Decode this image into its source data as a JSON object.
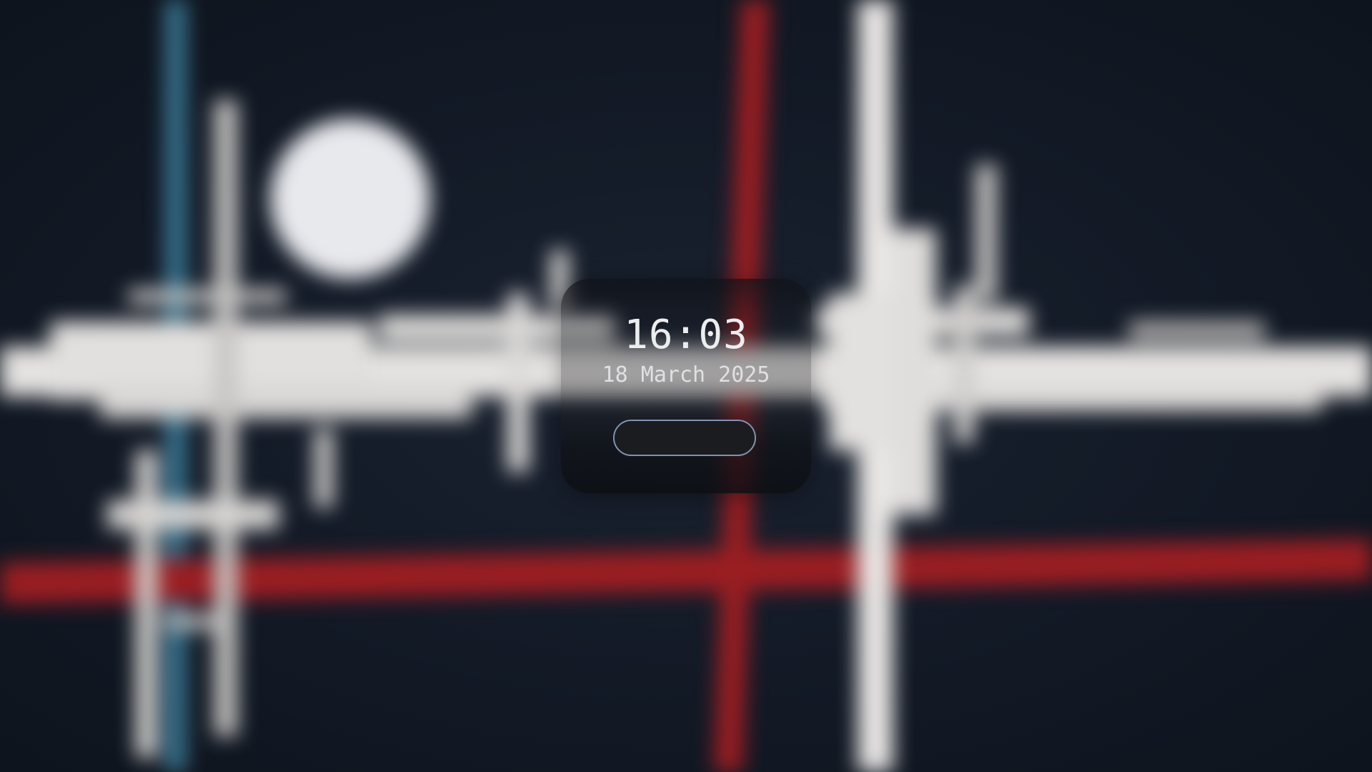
{
  "lockscreen": {
    "time": "16:03",
    "date": "18 March 2025",
    "password": {
      "value": "",
      "placeholder": ""
    }
  },
  "colors": {
    "wallpaper_background": "#131a25",
    "wallpaper_red": "#9a1e22",
    "wallpaper_blue": "#3a7a97",
    "wallpaper_white": "#e7e4e2",
    "input_border": "#7f93b0",
    "input_background": "#1b1c20",
    "text": "#ecedef"
  },
  "icons": []
}
